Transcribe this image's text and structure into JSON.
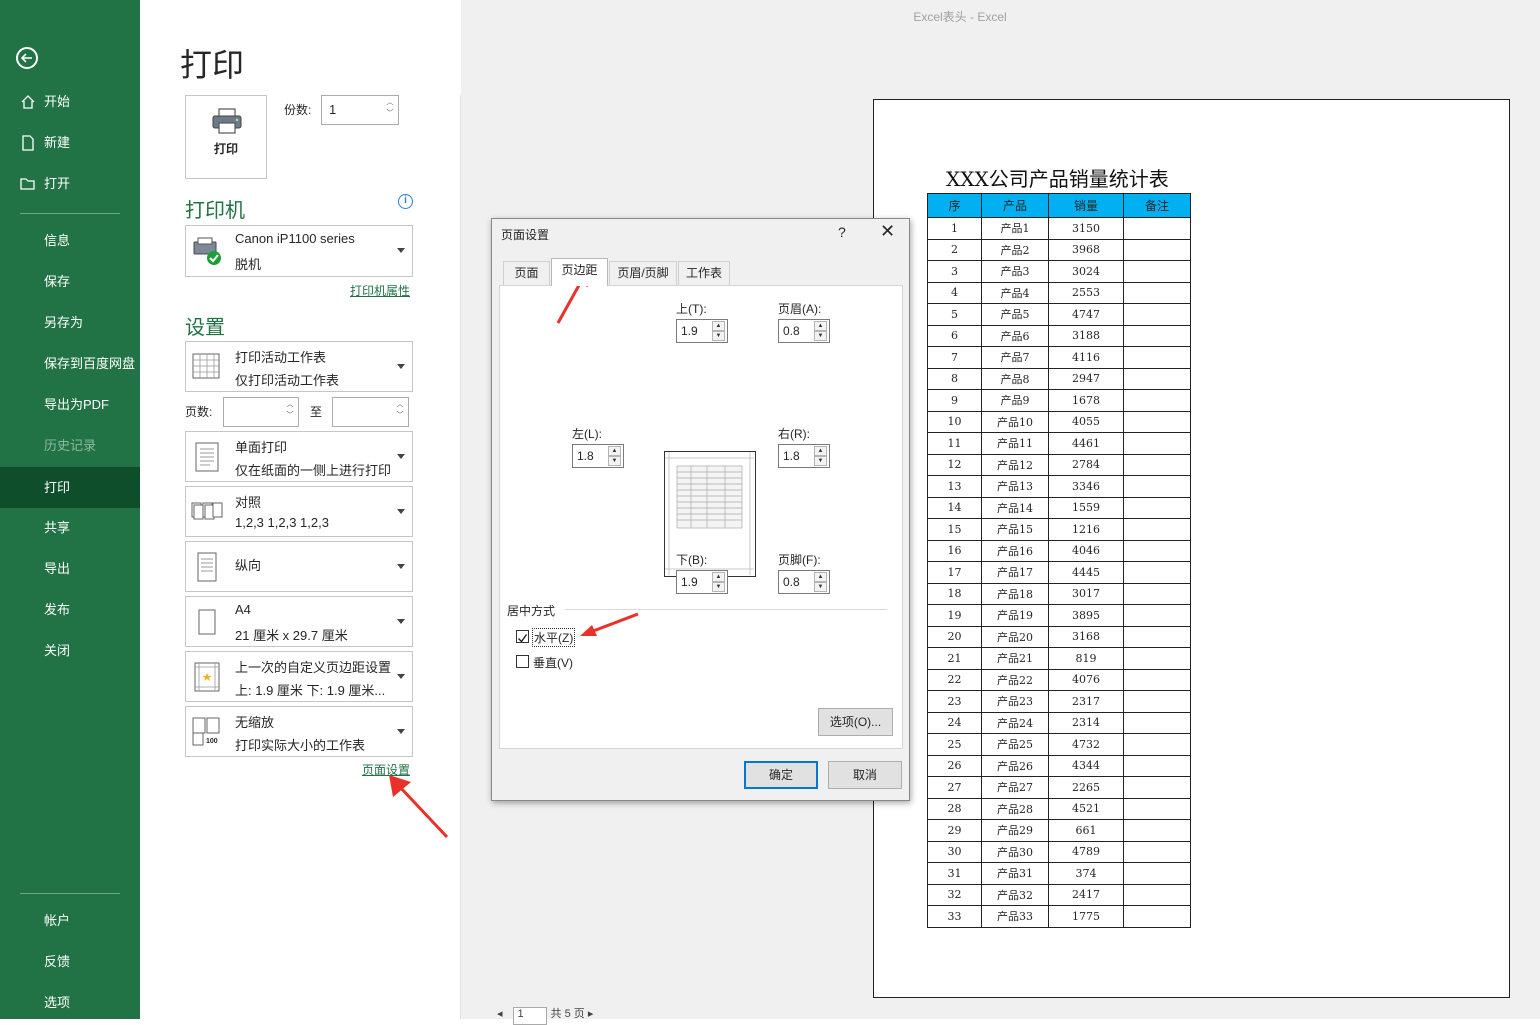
{
  "window": {
    "title": "Excel表头  -  Excel"
  },
  "sidebar": {
    "items": [
      {
        "label": "开始"
      },
      {
        "label": "新建"
      },
      {
        "label": "打开"
      },
      {
        "label": "信息"
      },
      {
        "label": "保存"
      },
      {
        "label": "另存为"
      },
      {
        "label": "保存到百度网盘"
      },
      {
        "label": "导出为PDF"
      },
      {
        "label": "历史记录"
      },
      {
        "label": "打印"
      },
      {
        "label": "共享"
      },
      {
        "label": "导出"
      },
      {
        "label": "发布"
      },
      {
        "label": "关闭"
      },
      {
        "label": "帐户"
      },
      {
        "label": "反馈"
      },
      {
        "label": "选项"
      }
    ],
    "active": "打印",
    "disabled": "历史记录",
    "bg_color": "#217346"
  },
  "print": {
    "page_title": "打印",
    "print_button": "打印",
    "copies_label": "份数:",
    "copies_value": "1",
    "printer_heading": "打印机",
    "printer_name": "Canon iP1100 series",
    "printer_status": "脱机",
    "printer_props_link": "打印机属性",
    "settings_heading": "设置",
    "what": {
      "l1": "打印活动工作表",
      "l2": "仅打印活动工作表"
    },
    "pages_label": "页数:",
    "pages_to": "至",
    "sides": {
      "l1": "单面打印",
      "l2": "仅在纸面的一侧上进行打印"
    },
    "collate": {
      "l1": "对照",
      "l2": "1,2,3     1,2,3     1,2,3"
    },
    "orientation": {
      "l1": "纵向"
    },
    "paper": {
      "l1": "A4",
      "l2": "21 厘米 x 29.7 厘米"
    },
    "margins": {
      "l1": "上一次的自定义页边距设置",
      "l2": "上: 1.9 厘米 下: 1.9 厘米..."
    },
    "scaling": {
      "l1": "无缩放",
      "l2": "打印实际大小的工作表",
      "icon_text": "100"
    },
    "page_setup_link": "页面设置"
  },
  "preview": {
    "sheet_title": "XXX公司产品销量统计表",
    "headers": [
      "序",
      "产品",
      "销量",
      "备注"
    ],
    "rows": [
      [
        "1",
        "产品1",
        "3150",
        ""
      ],
      [
        "2",
        "产品2",
        "3968",
        ""
      ],
      [
        "3",
        "产品3",
        "3024",
        ""
      ],
      [
        "4",
        "产品4",
        "2553",
        ""
      ],
      [
        "5",
        "产品5",
        "4747",
        ""
      ],
      [
        "6",
        "产品6",
        "3188",
        ""
      ],
      [
        "7",
        "产品7",
        "4116",
        ""
      ],
      [
        "8",
        "产品8",
        "2947",
        ""
      ],
      [
        "9",
        "产品9",
        "1678",
        ""
      ],
      [
        "10",
        "产品10",
        "4055",
        ""
      ],
      [
        "11",
        "产品11",
        "4461",
        ""
      ],
      [
        "12",
        "产品12",
        "2784",
        ""
      ],
      [
        "13",
        "产品13",
        "3346",
        ""
      ],
      [
        "14",
        "产品14",
        "1559",
        ""
      ],
      [
        "15",
        "产品15",
        "1216",
        ""
      ],
      [
        "16",
        "产品16",
        "4046",
        ""
      ],
      [
        "17",
        "产品17",
        "4445",
        ""
      ],
      [
        "18",
        "产品18",
        "3017",
        ""
      ],
      [
        "19",
        "产品19",
        "3895",
        ""
      ],
      [
        "20",
        "产品20",
        "3168",
        ""
      ],
      [
        "21",
        "产品21",
        "819",
        ""
      ],
      [
        "22",
        "产品22",
        "4076",
        ""
      ],
      [
        "23",
        "产品23",
        "2317",
        ""
      ],
      [
        "24",
        "产品24",
        "2314",
        ""
      ],
      [
        "25",
        "产品25",
        "4732",
        ""
      ],
      [
        "26",
        "产品26",
        "4344",
        ""
      ],
      [
        "27",
        "产品27",
        "2265",
        ""
      ],
      [
        "28",
        "产品28",
        "4521",
        ""
      ],
      [
        "29",
        "产品29",
        "661",
        ""
      ],
      [
        "30",
        "产品30",
        "4789",
        ""
      ],
      [
        "31",
        "产品31",
        "374",
        ""
      ],
      [
        "32",
        "产品32",
        "2417",
        ""
      ],
      [
        "33",
        "产品33",
        "1775",
        ""
      ]
    ],
    "header_color": "#00b0f0",
    "pager": {
      "current": "1",
      "text": "共 5 页"
    }
  },
  "dialog": {
    "title": "页面设置",
    "help": "?",
    "close": "✕",
    "tabs": [
      "页面",
      "页边距",
      "页眉/页脚",
      "工作表"
    ],
    "active_tab": "页边距",
    "top_label": "上(T):",
    "top_value": "1.9",
    "header_label": "页眉(A):",
    "header_value": "0.8",
    "left_label": "左(L):",
    "left_value": "1.8",
    "right_label": "右(R):",
    "right_value": "1.8",
    "bottom_label": "下(B):",
    "bottom_value": "1.9",
    "footer_label": "页脚(F):",
    "footer_value": "0.8",
    "center_group": "居中方式",
    "horizontal_label": "水平(Z)",
    "horizontal_checked": true,
    "vertical_label": "垂直(V)",
    "vertical_checked": false,
    "options_button": "选项(O)...",
    "ok_button": "确定",
    "cancel_button": "取消"
  }
}
